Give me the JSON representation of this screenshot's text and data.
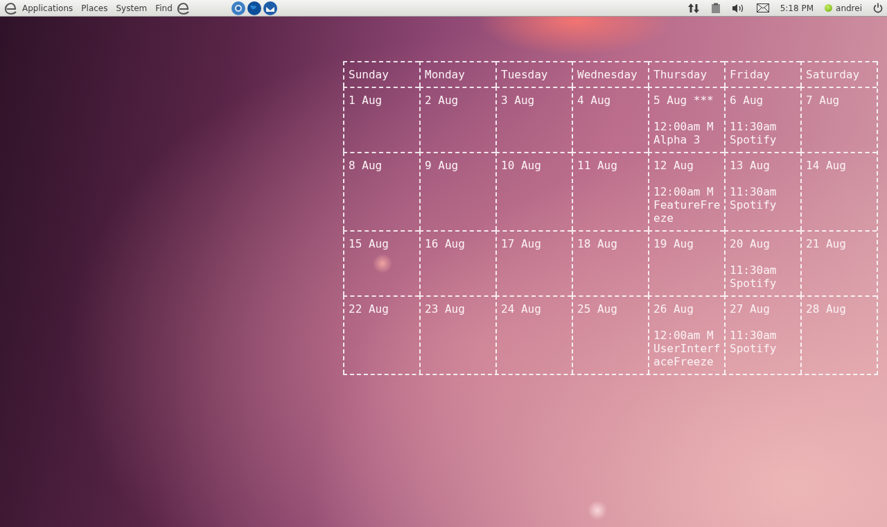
{
  "top_panel": {
    "menus": [
      "Applications",
      "Places",
      "System",
      "Find"
    ],
    "clock": "5:18 PM",
    "user": "andrei"
  },
  "calendar": {
    "weekdays": [
      "Sunday",
      "Monday",
      "Tuesday",
      "Wednesday",
      "Thursday",
      "Friday",
      "Saturday"
    ],
    "weeks": [
      [
        {
          "date": "1 Aug"
        },
        {
          "date": "2 Aug"
        },
        {
          "date": "3 Aug"
        },
        {
          "date": "4 Aug"
        },
        {
          "date": "5 Aug ***",
          "events": [
            "12:00am M",
            "Alpha 3"
          ]
        },
        {
          "date": "6 Aug",
          "events": [
            "11:30am",
            "Spotify"
          ]
        },
        {
          "date": "7 Aug"
        }
      ],
      [
        {
          "date": "8 Aug"
        },
        {
          "date": "9 Aug"
        },
        {
          "date": "10 Aug"
        },
        {
          "date": "11 Aug"
        },
        {
          "date": "12 Aug",
          "events": [
            "12:00am M",
            "FeatureFre",
            "eze"
          ]
        },
        {
          "date": "13 Aug",
          "events": [
            "11:30am",
            "Spotify"
          ]
        },
        {
          "date": "14 Aug"
        }
      ],
      [
        {
          "date": "15 Aug"
        },
        {
          "date": "16 Aug"
        },
        {
          "date": "17 Aug"
        },
        {
          "date": "18 Aug"
        },
        {
          "date": "19 Aug"
        },
        {
          "date": "20 Aug",
          "events": [
            "11:30am",
            "Spotify"
          ]
        },
        {
          "date": "21 Aug"
        }
      ],
      [
        {
          "date": "22 Aug"
        },
        {
          "date": "23 Aug"
        },
        {
          "date": "24 Aug"
        },
        {
          "date": "25 Aug"
        },
        {
          "date": "26 Aug",
          "events": [
            "12:00am M",
            "UserInterf",
            "aceFreeze"
          ]
        },
        {
          "date": "27 Aug",
          "events": [
            "11:30am",
            "Spotify"
          ]
        },
        {
          "date": "28 Aug"
        }
      ]
    ]
  }
}
